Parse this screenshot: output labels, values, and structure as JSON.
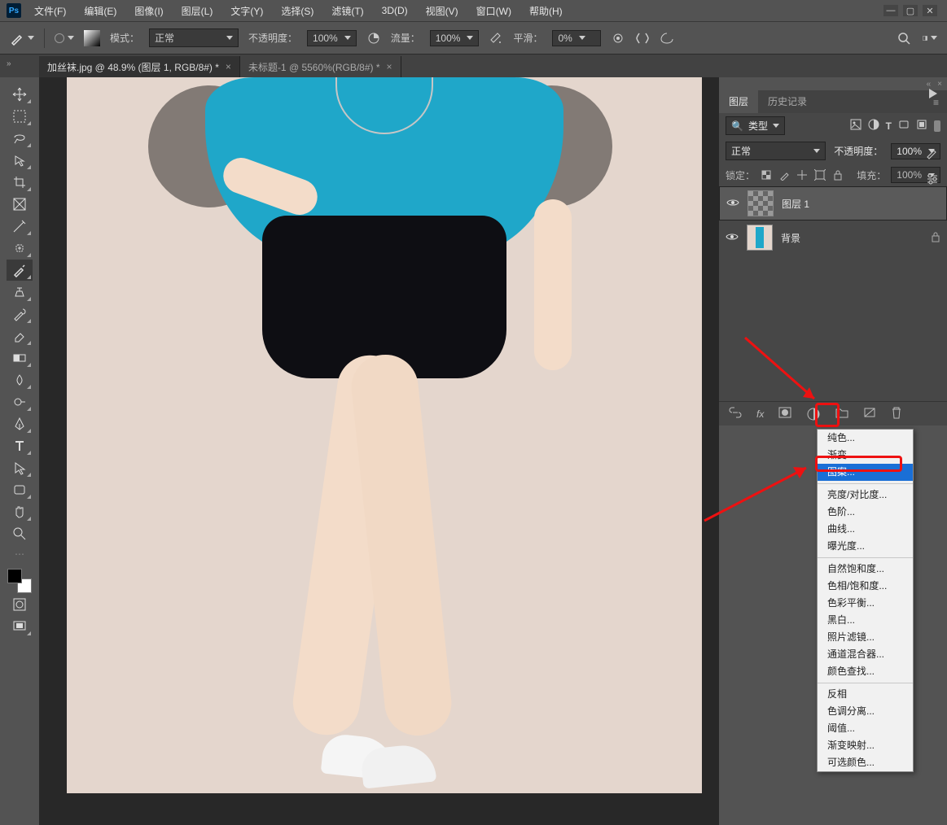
{
  "menubar": {
    "items": [
      "文件(F)",
      "编辑(E)",
      "图像(I)",
      "图层(L)",
      "文字(Y)",
      "选择(S)",
      "滤镜(T)",
      "3D(D)",
      "视图(V)",
      "窗口(W)",
      "帮助(H)"
    ]
  },
  "optbar": {
    "mode_label": "模式：",
    "mode_value": "正常",
    "opacity_label": "不透明度：",
    "opacity_value": "100%",
    "flow_label": "流量：",
    "flow_value": "100%",
    "smooth_label": "平滑：",
    "smooth_value": "0%"
  },
  "doc_tabs": {
    "active": "加丝袜.jpg @ 48.9% (图层 1, RGB/8#) *",
    "inactive": "未标题-1 @ 5560%(RGB/8#) *"
  },
  "layers_panel": {
    "tab_layers": "图层",
    "tab_history": "历史记录",
    "filter_label": "类型",
    "blend_mode": "正常",
    "opacity_label": "不透明度：",
    "opacity_value": "100%",
    "lock_label": "锁定：",
    "fill_label": "填充：",
    "fill_value": "100%",
    "layers": [
      {
        "name": "图层 1",
        "locked": false
      },
      {
        "name": "背景",
        "locked": true
      }
    ]
  },
  "popup": {
    "items_top": [
      "纯色...",
      "渐变...",
      "图案..."
    ],
    "items_adj1": [
      "亮度/对比度...",
      "色阶...",
      "曲线...",
      "曝光度..."
    ],
    "items_adj2": [
      "自然饱和度...",
      "色相/饱和度...",
      "色彩平衡...",
      "黑白...",
      "照片滤镜...",
      "通道混合器...",
      "颜色查找..."
    ],
    "items_adj3": [
      "反相",
      "色调分离...",
      "阈值...",
      "渐变映射...",
      "可选颜色..."
    ],
    "highlight_index": 2
  },
  "search_icon": "🔍"
}
